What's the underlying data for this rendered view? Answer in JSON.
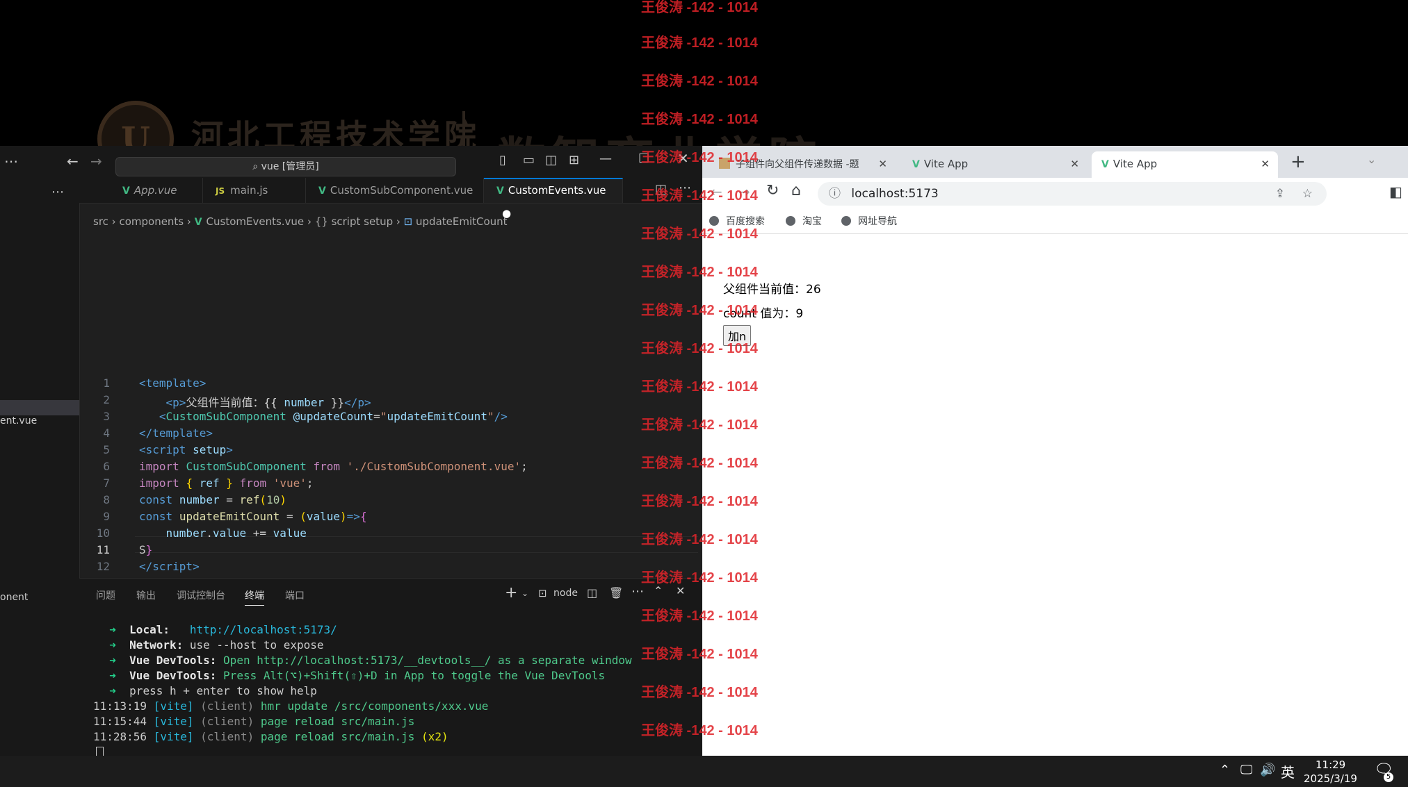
{
  "banner": {
    "seal": "U",
    "school": "河北工程技术学院",
    "dept": "数智商业学院"
  },
  "vscode": {
    "search": "vue [管理员]",
    "sidebar_items": [
      "ent.vue",
      "onent"
    ],
    "tabs": [
      {
        "label": "App.vue",
        "icon": "vue-icon"
      },
      {
        "label": "main.js",
        "icon": "js-icon",
        "icon_text": "JS"
      },
      {
        "label": "CustomSubComponent.vue",
        "icon": "vue-icon"
      },
      {
        "label": "CustomEvents.vue",
        "icon": "vue-icon"
      }
    ],
    "breadcrumb": [
      "src",
      "components",
      "CustomEvents.vue",
      "{} script setup",
      "updateEmitCount"
    ],
    "line_numbers": [
      "1",
      "2",
      "3",
      "4",
      "5",
      "6",
      "7",
      "8",
      "9",
      "10",
      "11",
      "12"
    ],
    "panel_tabs": [
      "问题",
      "输出",
      "调试控制台",
      "终端",
      "端口"
    ],
    "terminal_name": "node",
    "terminal": {
      "local_label": "Local:",
      "local_url": "http://localhost:5173/",
      "network_label": "Network:",
      "network_text": "use --host to expose",
      "devtools_label": "Vue DevTools:",
      "devtools_1": "Open http://localhost:5173/__devtools__/ as a separate window",
      "devtools_2": "Press Alt(⌥)+Shift(⇧)+D in App to toggle the Vue DevTools",
      "help": "press h + enter to show help",
      "log": [
        {
          "time": "11:13:19",
          "tag": "[vite]",
          "src": "(client)",
          "msg": "hmr update /src/components/xxx.vue",
          "extra": ""
        },
        {
          "time": "11:15:44",
          "tag": "[vite]",
          "src": "(client)",
          "msg": "page reload src/main.js",
          "extra": ""
        },
        {
          "time": "11:28:56",
          "tag": "[vite]",
          "src": "(client)",
          "msg": "page reload src/main.js",
          "extra": "(x2)"
        }
      ]
    }
  },
  "browser": {
    "tabs": [
      {
        "label": "子组件向父组件传递数据 -题"
      },
      {
        "label": "Vite App"
      },
      {
        "label": "Vite App"
      }
    ],
    "url": "localhost:5173",
    "bookmarks": [
      "百度搜索",
      "淘宝",
      "网址导航"
    ],
    "page": {
      "parent_value": "父组件当前值：26",
      "count_value": "count 值为：9",
      "button": "加n"
    }
  },
  "watermark": "王俊涛 -142 - 1014",
  "taskbar": {
    "ime": "英",
    "time": "11:29",
    "date": "2025/3/19",
    "notif_count": "5"
  }
}
